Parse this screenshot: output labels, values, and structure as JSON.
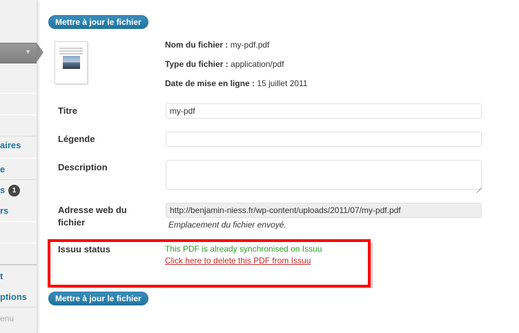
{
  "sidebar": {
    "items": [
      {
        "label": "aires"
      },
      {
        "label": "e"
      },
      {
        "label": "s"
      },
      {
        "label": "rs"
      },
      {
        "label": "t"
      },
      {
        "label": "ptions"
      }
    ],
    "badge": "1",
    "collapse_label": "enu"
  },
  "buttons": {
    "update_top": "Mettre à jour le fichier",
    "update_bottom": "Mettre à jour le fichier"
  },
  "file": {
    "name_label": "Nom du fichier :",
    "name_value": "my-pdf.pdf",
    "type_label": "Type du fichier :",
    "type_value": "application/pdf",
    "date_label": "Date de mise en ligne :",
    "date_value": "15 juillet 2011"
  },
  "form": {
    "title_label": "Titre",
    "title_value": "my-pdf",
    "caption_label": "Légende",
    "caption_value": "",
    "description_label": "Description",
    "description_value": "",
    "url_label_line1": "Adresse web du",
    "url_label_line2": "fichier",
    "url_value": "http://benjamin-niess.fr/wp-content/uploads/2011/07/my-pdf.pdf",
    "url_help": "Emplacement du fichier envoyé."
  },
  "issuu": {
    "label": "Issuu status",
    "status_text": "This PDF is already synchronised on Issuu",
    "delete_link": "Click here to delete this PDF from Issuu",
    "status_color": "#24a324",
    "link_color": "#c62828",
    "highlight_color": "#ff0000"
  },
  "icons": [
    "chevron-down-icon",
    "pdf-thumbnail",
    "resize-grip-icon"
  ]
}
